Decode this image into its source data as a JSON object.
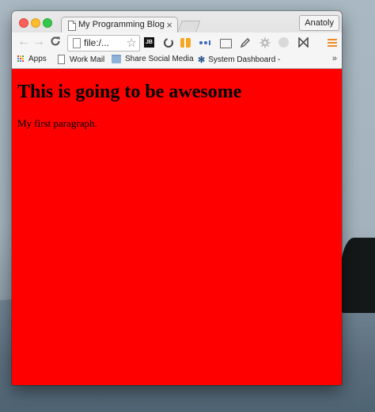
{
  "window": {
    "tab": {
      "title": "My Programming Blog",
      "close_glyph": "×"
    },
    "profile_name": "Anatoly"
  },
  "toolbar": {
    "back_glyph": "←",
    "forward_glyph": "→",
    "reload_glyph": "C",
    "address": "file:/...",
    "star_glyph": "☆",
    "extensions": [
      {
        "name": "jetbrains-icon",
        "label": "JB"
      },
      {
        "name": "sync-icon"
      },
      {
        "name": "gift-icon"
      },
      {
        "name": "dots-icon"
      },
      {
        "name": "cast-icon"
      },
      {
        "name": "pencil-icon"
      },
      {
        "name": "gear-icon"
      },
      {
        "name": "circle-icon"
      },
      {
        "name": "bowtie-icon"
      }
    ],
    "menu_icon": "hamburger-icon"
  },
  "bookmarks": [
    {
      "label": "Apps",
      "icon": "apps-grid-icon"
    },
    {
      "label": "Work Mail",
      "icon": "document-icon"
    },
    {
      "label": "Share Social Media",
      "icon": "folder-icon"
    },
    {
      "label": "System Dashboard -",
      "icon": "system-icon"
    }
  ],
  "bookmarks_overflow": "»",
  "page": {
    "heading": "This is going to be awesome",
    "paragraph": "My first paragraph.",
    "background_color": "#ff0000"
  },
  "colors": {
    "close": "#fc5f57",
    "minimize": "#fdbb2e",
    "maximize": "#34c84a",
    "menu_accent": "#f08a24"
  }
}
